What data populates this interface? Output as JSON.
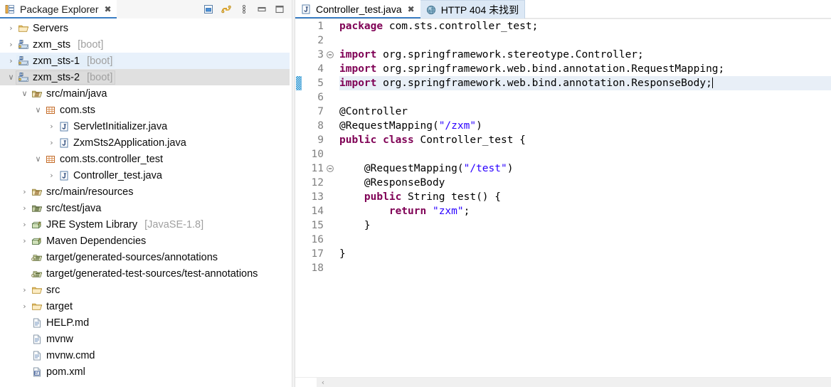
{
  "explorer": {
    "tab": {
      "title": "Package Explorer",
      "close": "✖",
      "icon": "package-explorer-icon"
    },
    "toolbar": [
      {
        "name": "collapse-all-icon",
        "tooltip": "Collapse All"
      },
      {
        "name": "link-with-editor-icon",
        "tooltip": "Link with Editor"
      },
      {
        "name": "view-menu-icon",
        "tooltip": "View Menu"
      },
      {
        "name": "minimize-icon",
        "tooltip": "Minimize"
      },
      {
        "name": "maximize-icon",
        "tooltip": "Maximize"
      }
    ],
    "tree": [
      {
        "indent": 0,
        "arrow": "›",
        "icon": "folder-servers",
        "label": "Servers",
        "sub": "",
        "state": "normal"
      },
      {
        "indent": 0,
        "arrow": "›",
        "icon": "maven-project",
        "label": "zxm_sts",
        "sub": "[boot]",
        "state": "normal"
      },
      {
        "indent": 0,
        "arrow": "›",
        "icon": "maven-project",
        "label": "zxm_sts-1",
        "sub": "[boot]",
        "state": "hover"
      },
      {
        "indent": 0,
        "arrow": "∨",
        "icon": "maven-project",
        "label": "zxm_sts-2",
        "sub": "[boot]",
        "state": "selected"
      },
      {
        "indent": 1,
        "arrow": "∨",
        "icon": "source-folder",
        "label": "src/main/java",
        "sub": "",
        "state": "normal"
      },
      {
        "indent": 2,
        "arrow": "∨",
        "icon": "package",
        "label": "com.sts",
        "sub": "",
        "state": "normal"
      },
      {
        "indent": 3,
        "arrow": "›",
        "icon": "java-file",
        "label": "ServletInitializer.java",
        "sub": "",
        "state": "normal"
      },
      {
        "indent": 3,
        "arrow": "›",
        "icon": "java-file",
        "label": "ZxmSts2Application.java",
        "sub": "",
        "state": "normal"
      },
      {
        "indent": 2,
        "arrow": "∨",
        "icon": "package",
        "label": "com.sts.controller_test",
        "sub": "",
        "state": "normal"
      },
      {
        "indent": 3,
        "arrow": "›",
        "icon": "java-file",
        "label": "Controller_test.java",
        "sub": "",
        "state": "normal"
      },
      {
        "indent": 1,
        "arrow": "›",
        "icon": "source-folder",
        "label": "src/main/resources",
        "sub": "",
        "state": "normal"
      },
      {
        "indent": 1,
        "arrow": "›",
        "icon": "source-folder-dark",
        "label": "src/test/java",
        "sub": "",
        "state": "normal"
      },
      {
        "indent": 1,
        "arrow": "›",
        "icon": "library",
        "label": "JRE System Library",
        "sub": "[JavaSE-1.8]",
        "state": "normal"
      },
      {
        "indent": 1,
        "arrow": "›",
        "icon": "library",
        "label": "Maven Dependencies",
        "sub": "",
        "state": "normal"
      },
      {
        "indent": 1,
        "arrow": "",
        "icon": "generated-source-folder",
        "label": "target/generated-sources/annotations",
        "sub": "",
        "state": "normal"
      },
      {
        "indent": 1,
        "arrow": "",
        "icon": "generated-source-folder",
        "label": "target/generated-test-sources/test-annotations",
        "sub": "",
        "state": "normal"
      },
      {
        "indent": 1,
        "arrow": "›",
        "icon": "folder",
        "label": "src",
        "sub": "",
        "state": "normal"
      },
      {
        "indent": 1,
        "arrow": "›",
        "icon": "folder",
        "label": "target",
        "sub": "",
        "state": "normal"
      },
      {
        "indent": 1,
        "arrow": "",
        "icon": "text-file",
        "label": "HELP.md",
        "sub": "",
        "state": "normal"
      },
      {
        "indent": 1,
        "arrow": "",
        "icon": "text-file",
        "label": "mvnw",
        "sub": "",
        "state": "normal"
      },
      {
        "indent": 1,
        "arrow": "",
        "icon": "text-file",
        "label": "mvnw.cmd",
        "sub": "",
        "state": "normal"
      },
      {
        "indent": 1,
        "arrow": "",
        "icon": "xml-file",
        "label": "pom.xml",
        "sub": "",
        "state": "normal"
      }
    ]
  },
  "editor": {
    "tabs": [
      {
        "label": "Controller_test.java",
        "icon": "java-file-icon",
        "close": "✖",
        "active": true
      },
      {
        "label": "HTTP 404 未找到",
        "icon": "browser-globe-icon",
        "close": "",
        "active": false
      }
    ],
    "current_line": 5,
    "change_marker_line": 5,
    "fold_lines": [
      3,
      11
    ],
    "lines": [
      {
        "n": 1,
        "tokens": [
          {
            "t": "package",
            "c": "kw"
          },
          {
            "t": " com.sts.controller_test;",
            "c": "pl"
          }
        ]
      },
      {
        "n": 2,
        "tokens": []
      },
      {
        "n": 3,
        "tokens": [
          {
            "t": "import",
            "c": "kw"
          },
          {
            "t": " org.springframework.stereotype.Controller;",
            "c": "pl"
          }
        ]
      },
      {
        "n": 4,
        "tokens": [
          {
            "t": "import",
            "c": "kw"
          },
          {
            "t": " org.springframework.web.bind.annotation.RequestMapping;",
            "c": "pl"
          }
        ]
      },
      {
        "n": 5,
        "tokens": [
          {
            "t": "import",
            "c": "kw"
          },
          {
            "t": " org.springframework.web.bind.annotation.ResponseBody;",
            "c": "pl"
          }
        ]
      },
      {
        "n": 6,
        "tokens": []
      },
      {
        "n": 7,
        "tokens": [
          {
            "t": "@Controller",
            "c": "pl"
          }
        ]
      },
      {
        "n": 8,
        "tokens": [
          {
            "t": "@RequestMapping(",
            "c": "pl"
          },
          {
            "t": "\"/zxm\"",
            "c": "str"
          },
          {
            "t": ")",
            "c": "pl"
          }
        ]
      },
      {
        "n": 9,
        "tokens": [
          {
            "t": "public class",
            "c": "kw"
          },
          {
            "t": " Controller_test {",
            "c": "pl"
          }
        ]
      },
      {
        "n": 10,
        "tokens": []
      },
      {
        "n": 11,
        "tokens": [
          {
            "t": "    @RequestMapping(",
            "c": "pl"
          },
          {
            "t": "\"/test\"",
            "c": "str"
          },
          {
            "t": ")",
            "c": "pl"
          }
        ]
      },
      {
        "n": 12,
        "tokens": [
          {
            "t": "    @ResponseBody",
            "c": "pl"
          }
        ]
      },
      {
        "n": 13,
        "tokens": [
          {
            "t": "    ",
            "c": "pl"
          },
          {
            "t": "public",
            "c": "kw"
          },
          {
            "t": " String test() {",
            "c": "pl"
          }
        ]
      },
      {
        "n": 14,
        "tokens": [
          {
            "t": "        ",
            "c": "pl"
          },
          {
            "t": "return",
            "c": "kw"
          },
          {
            "t": " ",
            "c": "pl"
          },
          {
            "t": "\"zxm\"",
            "c": "str"
          },
          {
            "t": ";",
            "c": "pl"
          }
        ]
      },
      {
        "n": 15,
        "tokens": [
          {
            "t": "    }",
            "c": "pl"
          }
        ]
      },
      {
        "n": 16,
        "tokens": []
      },
      {
        "n": 17,
        "tokens": [
          {
            "t": "}",
            "c": "pl"
          }
        ]
      },
      {
        "n": 18,
        "tokens": []
      }
    ],
    "hscroll": {
      "left_arrow": "‹"
    }
  },
  "colors": {
    "keyword": "#7f0055",
    "string": "#2a00ff",
    "plain": "#000000",
    "current_line_bg": "#e8eff7",
    "selection_bg": "#dcdcdc",
    "hover_bg": "#e8f1fb",
    "tab_underline": "#3b7ec4",
    "inactive_tab_bg": "#dce8f5",
    "gutter_text": "#808080",
    "muted_text": "#a0a0a0"
  }
}
